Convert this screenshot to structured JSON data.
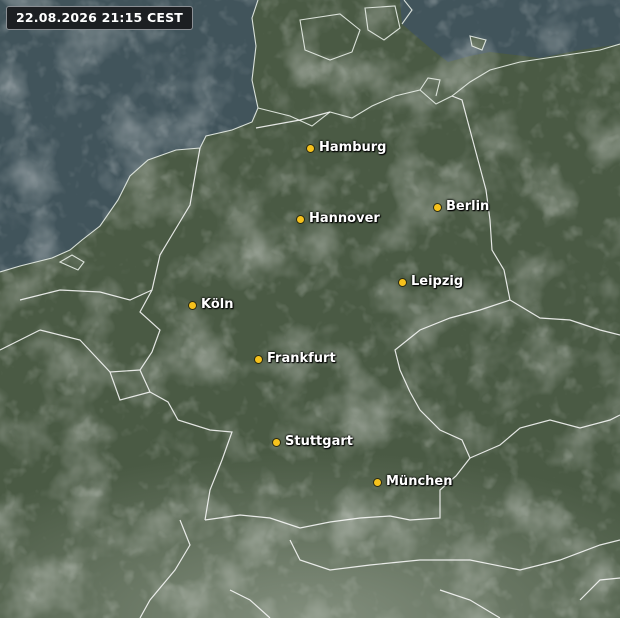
{
  "timestamp": "22.08.2026 21:15 CEST",
  "colors": {
    "sea": "#34474f",
    "land": "#4a5a44",
    "borders": "#ffffff",
    "city_marker": "#f6c21c",
    "label": "#ffffff"
  },
  "cities": [
    {
      "name": "Hamburg"
    },
    {
      "name": "Berlin"
    },
    {
      "name": "Hannover"
    },
    {
      "name": "Leipzig"
    },
    {
      "name": "Köln"
    },
    {
      "name": "Frankfurt"
    },
    {
      "name": "Stuttgart"
    },
    {
      "name": "München"
    }
  ]
}
